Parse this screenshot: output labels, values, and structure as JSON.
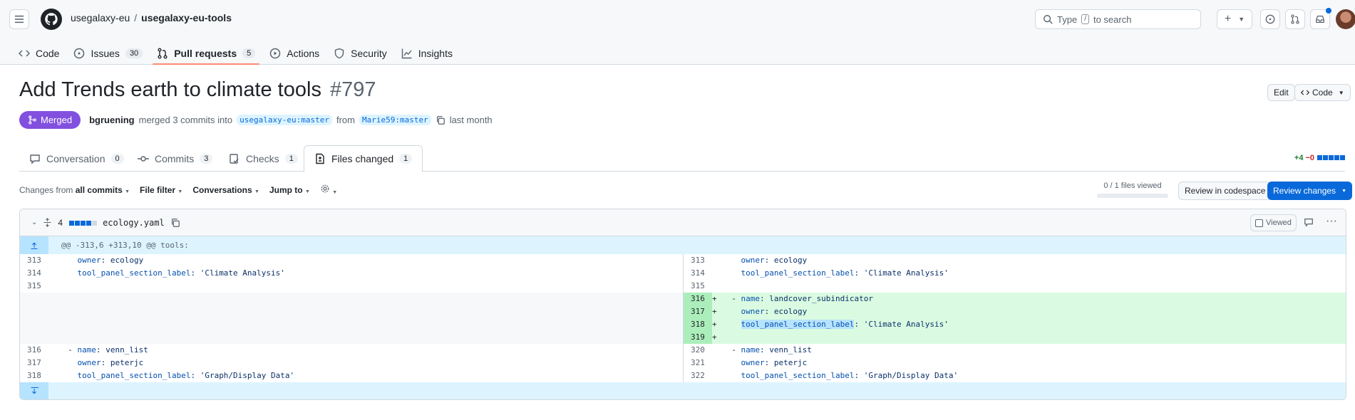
{
  "header": {
    "owner": "usegalaxy-eu",
    "separator": "/",
    "repo": "usegalaxy-eu-tools",
    "search_prefix": "Type",
    "search_key": "/",
    "search_suffix": "to search"
  },
  "repo_nav": [
    {
      "label": "Code",
      "icon": "code-icon"
    },
    {
      "label": "Issues",
      "count": "30",
      "icon": "issue-icon"
    },
    {
      "label": "Pull requests",
      "count": "5",
      "icon": "pull-request-icon",
      "active": true
    },
    {
      "label": "Actions",
      "icon": "play-icon"
    },
    {
      "label": "Security",
      "icon": "shield-icon"
    },
    {
      "label": "Insights",
      "icon": "graph-icon"
    }
  ],
  "pr": {
    "title": "Add Trends earth to climate tools",
    "number": "#797",
    "edit_label": "Edit",
    "code_label": "Code",
    "state": "Merged",
    "author": "bgruening",
    "action_text": "merged 3 commits into",
    "base_branch": "usegalaxy-eu:master",
    "from_text": "from",
    "head_branch": "Marie59:master",
    "time": "last month"
  },
  "tabs": [
    {
      "label": "Conversation",
      "count": "0",
      "icon": "comment-icon"
    },
    {
      "label": "Commits",
      "count": "3",
      "icon": "commit-icon"
    },
    {
      "label": "Checks",
      "count": "1",
      "icon": "checklist-icon"
    },
    {
      "label": "Files changed",
      "count": "1",
      "icon": "file-diff-icon",
      "active": true
    }
  ],
  "diffstat": {
    "additions": "+4",
    "deletions": "−0"
  },
  "toolbar": {
    "changes_from_prefix": "Changes from",
    "changes_from_value": "all commits",
    "file_filter": "File filter",
    "conversations": "Conversations",
    "jump_to": "Jump to",
    "files_viewed": "0 / 1 files viewed",
    "review_codespace": "Review in codespace",
    "review_changes": "Review changes"
  },
  "file": {
    "changes": "4",
    "name": "ecology.yaml",
    "viewed_label": "Viewed",
    "hunk_header": "@@ -313,6 +313,10 @@ tools:"
  },
  "colors": {
    "merged": "#8250df",
    "accent": "#0969da",
    "addition_bg": "#dafbe1",
    "hunk_bg": "#ddf4ff"
  },
  "diff_rows": [
    {
      "left_ln": "313",
      "left_key": "owner",
      "left_val": ": ecology",
      "right_ln": "313",
      "right_key": "owner",
      "right_val": ": ecology"
    },
    {
      "left_ln": "314",
      "left_key": "tool_panel_section_label",
      "left_val": ": 'Climate Analysis'",
      "right_ln": "314",
      "right_key": "tool_panel_section_label",
      "right_val": ": 'Climate Analysis'"
    },
    {
      "left_ln": "315",
      "right_ln": "315"
    },
    {
      "added": true,
      "right_ln": "316",
      "right_prefix": "- ",
      "right_key": "name",
      "right_val": ": landcover_subindicator"
    },
    {
      "added": true,
      "right_ln": "317",
      "right_key": "owner",
      "right_val": ": ecology"
    },
    {
      "added": true,
      "right_ln": "318",
      "right_key": "tool_panel_section_label",
      "right_val": ": 'Climate Analysis'",
      "highlight": true
    },
    {
      "added": true,
      "right_ln": "319"
    },
    {
      "left_ln": "316",
      "left_prefix": "- ",
      "left_key": "name",
      "left_val": ": venn_list",
      "right_ln": "320",
      "right_prefix": "- ",
      "right_key": "name",
      "right_val": ": venn_list"
    },
    {
      "left_ln": "317",
      "left_key": "owner",
      "left_val": ": peterjc",
      "right_ln": "321",
      "right_key": "owner",
      "right_val": ": peterjc"
    },
    {
      "left_ln": "318",
      "left_key": "tool_panel_section_label",
      "left_val": ": 'Graph/Display Data'",
      "right_ln": "322",
      "right_key": "tool_panel_section_label",
      "right_val": ": 'Graph/Display Data'"
    }
  ]
}
